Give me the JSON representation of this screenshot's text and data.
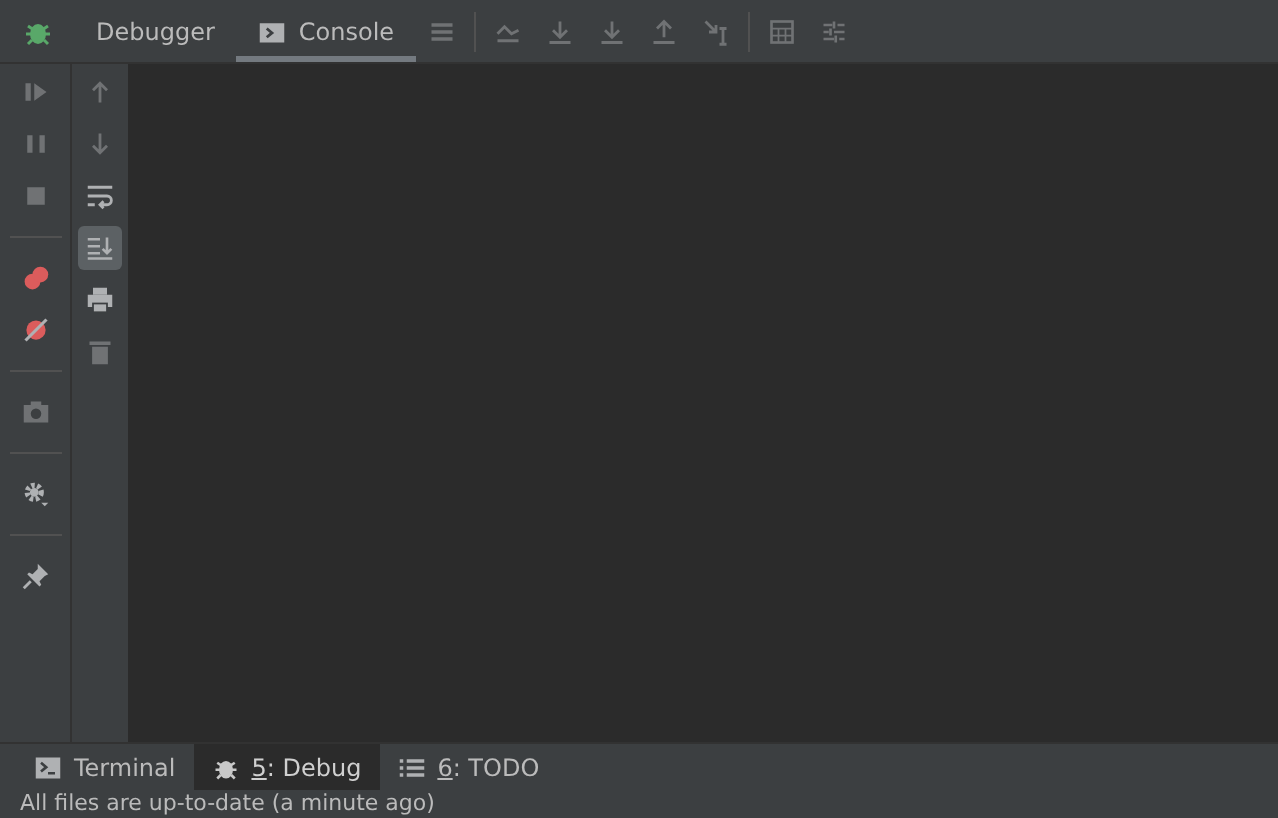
{
  "toolbar": {
    "tabs": [
      {
        "label": "Debugger",
        "selected": false,
        "kind": "plain"
      },
      {
        "label": "Console",
        "selected": true,
        "kind": "console"
      }
    ],
    "actions": [
      {
        "kind": "lines",
        "disabled": true
      },
      {
        "kind": "step-over",
        "disabled": true
      },
      {
        "kind": "step-into",
        "disabled": true
      },
      {
        "kind": "step-into",
        "disabled": true
      },
      {
        "kind": "step-out",
        "disabled": true
      },
      {
        "kind": "cursor",
        "disabled": true
      },
      {
        "kind": "table",
        "disabled": true
      },
      {
        "kind": "trace",
        "disabled": true
      }
    ]
  },
  "debug_toolbar": [
    {
      "kind": "resume",
      "disabled": true
    },
    {
      "kind": "pause",
      "disabled": true
    },
    {
      "kind": "stop",
      "disabled": true
    },
    {
      "kind": "breakpoints",
      "disabled": false
    },
    {
      "kind": "mute",
      "disabled": false
    },
    {
      "kind": "camera",
      "disabled": true
    },
    {
      "kind": "gear",
      "disabled": false
    },
    {
      "kind": "pin",
      "disabled": false
    }
  ],
  "console_toolbar": [
    {
      "kind": "up",
      "disabled": true,
      "selected": false
    },
    {
      "kind": "down",
      "disabled": true,
      "selected": false
    },
    {
      "kind": "wrap",
      "disabled": false,
      "selected": false
    },
    {
      "kind": "scroll-end",
      "disabled": false,
      "selected": true
    },
    {
      "kind": "print",
      "disabled": false,
      "selected": false
    },
    {
      "kind": "trash",
      "disabled": true,
      "selected": false
    }
  ],
  "bottom_tabs": [
    {
      "kind": "terminal",
      "rest": "Terminal",
      "selected": false
    },
    {
      "kind": "bug",
      "mnemonic": "5",
      "rest": ": Debug",
      "selected": true
    },
    {
      "kind": "list",
      "mnemonic": "6",
      "rest": ": TODO",
      "selected": false
    }
  ],
  "status_bar": "All files are up-to-date (a minute ago)"
}
